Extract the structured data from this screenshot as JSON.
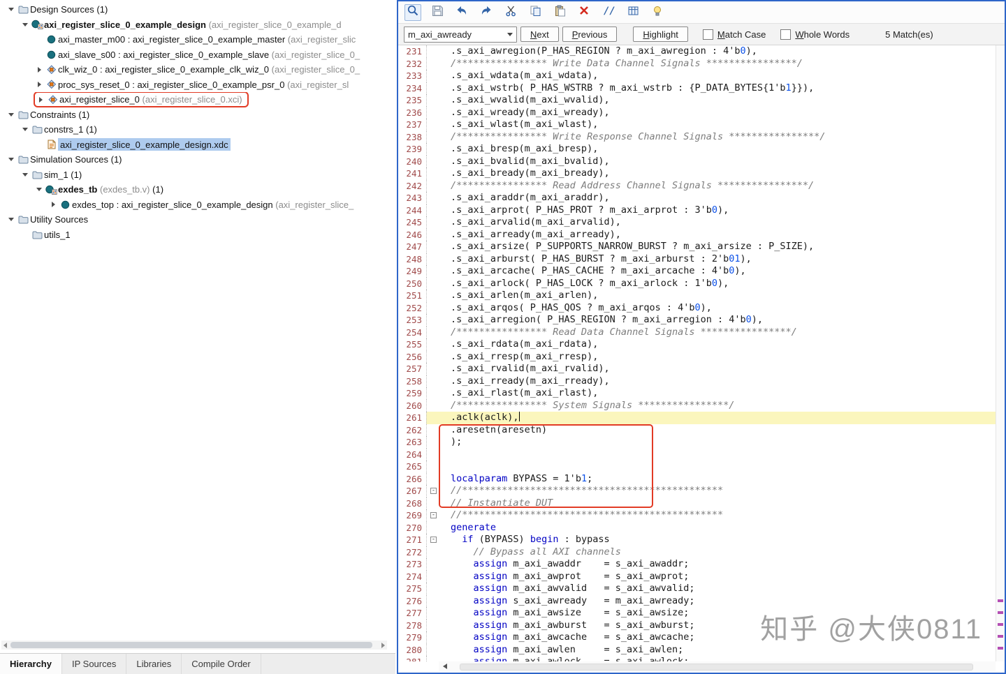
{
  "left_panel": {
    "tree": [
      {
        "indent": 0,
        "chevron": "v",
        "icon": "folder",
        "parts": [
          {
            "t": "Design Sources ",
            "s": "plain"
          },
          {
            "t": "(1)",
            "s": "plain"
          }
        ]
      },
      {
        "indent": 1,
        "chevron": "v",
        "icon": "module-h",
        "parts": [
          {
            "t": "axi_register_slice_0_example_design ",
            "s": "bold"
          },
          {
            "t": "(axi_register_slice_0_example_d",
            "s": "dim"
          }
        ]
      },
      {
        "indent": 2,
        "chevron": null,
        "icon": "module",
        "parts": [
          {
            "t": "axi_master_m00 : axi_register_slice_0_example_master ",
            "s": "plain"
          },
          {
            "t": "(axi_register_slic",
            "s": "dim"
          }
        ]
      },
      {
        "indent": 2,
        "chevron": null,
        "icon": "module",
        "parts": [
          {
            "t": "axi_slave_s00 : axi_register_slice_0_example_slave ",
            "s": "plain"
          },
          {
            "t": "(axi_register_slice_0_",
            "s": "dim"
          }
        ]
      },
      {
        "indent": 2,
        "chevron": ">",
        "icon": "ip",
        "parts": [
          {
            "t": "clk_wiz_0 : axi_register_slice_0_example_clk_wiz_0 ",
            "s": "plain"
          },
          {
            "t": "(axi_register_slice_0_",
            "s": "dim"
          }
        ]
      },
      {
        "indent": 2,
        "chevron": ">",
        "icon": "ip",
        "parts": [
          {
            "t": "proc_sys_reset_0 : axi_register_slice_0_example_psr_0 ",
            "s": "plain"
          },
          {
            "t": "(axi_register_sl",
            "s": "dim"
          }
        ]
      },
      {
        "indent": 2,
        "chevron": ">",
        "icon": "ip",
        "redbox": true,
        "parts": [
          {
            "t": "axi_register_slice_0 ",
            "s": "plain"
          },
          {
            "t": "(axi_register_slice_0.xci)",
            "s": "dim"
          }
        ]
      },
      {
        "indent": 0,
        "chevron": "v",
        "icon": "folder",
        "parts": [
          {
            "t": "Constraints ",
            "s": "plain"
          },
          {
            "t": "(1)",
            "s": "plain"
          }
        ]
      },
      {
        "indent": 1,
        "chevron": "v",
        "icon": "folder",
        "parts": [
          {
            "t": "constrs_1 ",
            "s": "plain"
          },
          {
            "t": "(1)",
            "s": "plain"
          }
        ]
      },
      {
        "indent": 2,
        "chevron": null,
        "icon": "xdc",
        "selected": true,
        "parts": [
          {
            "t": "axi_register_slice_0_example_design.xdc",
            "s": "plain"
          }
        ]
      },
      {
        "indent": 0,
        "chevron": "v",
        "icon": "folder",
        "parts": [
          {
            "t": "Simulation Sources ",
            "s": "plain"
          },
          {
            "t": "(1)",
            "s": "plain"
          }
        ]
      },
      {
        "indent": 1,
        "chevron": "v",
        "icon": "folder",
        "parts": [
          {
            "t": "sim_1 ",
            "s": "plain"
          },
          {
            "t": "(1)",
            "s": "plain"
          }
        ]
      },
      {
        "indent": 2,
        "chevron": "v",
        "icon": "module-h",
        "parts": [
          {
            "t": "exdes_tb ",
            "s": "bold"
          },
          {
            "t": "(exdes_tb.v) ",
            "s": "dim"
          },
          {
            "t": "(1)",
            "s": "plain"
          }
        ]
      },
      {
        "indent": 3,
        "chevron": ">",
        "icon": "module",
        "parts": [
          {
            "t": "exdes_top : axi_register_slice_0_example_design ",
            "s": "plain"
          },
          {
            "t": "(axi_register_slice_",
            "s": "dim"
          }
        ]
      },
      {
        "indent": 0,
        "chevron": "v",
        "icon": "folder",
        "parts": [
          {
            "t": "Utility Sources",
            "s": "plain"
          }
        ]
      },
      {
        "indent": 1,
        "chevron": null,
        "icon": "folder",
        "parts": [
          {
            "t": "utils_1",
            "s": "plain"
          }
        ]
      }
    ],
    "tabs": [
      {
        "label": "Hierarchy",
        "active": true
      },
      {
        "label": "IP Sources",
        "active": false
      },
      {
        "label": "Libraries",
        "active": false
      },
      {
        "label": "Compile Order",
        "active": false
      }
    ]
  },
  "editor": {
    "toolbar": [
      {
        "name": "find",
        "icon": "search-icon",
        "active": true
      },
      {
        "name": "save",
        "icon": "save-icon",
        "active": false
      },
      {
        "name": "undo",
        "icon": "undo-arrow-icon",
        "active": false
      },
      {
        "name": "redo",
        "icon": "redo-arrow-icon",
        "active": false
      },
      {
        "name": "cut",
        "icon": "scissors-icon",
        "active": false
      },
      {
        "name": "copy",
        "icon": "copy-icon",
        "active": false
      },
      {
        "name": "paste",
        "icon": "paste-icon",
        "active": false
      },
      {
        "name": "delete",
        "icon": "delete-x-icon",
        "active": false
      },
      {
        "name": "toggle-comment",
        "icon": "comment-slashes-icon",
        "active": false
      },
      {
        "name": "column-select",
        "icon": "grid-icon",
        "active": false
      },
      {
        "name": "quick-fix",
        "icon": "lightbulb-icon",
        "active": false
      }
    ],
    "find": {
      "query": "m_axi_awready",
      "next_label": "Next",
      "previous_label": "Previous",
      "highlight_label": "Highlight",
      "match_case_label": "Match Case",
      "whole_words_label": "Whole Words",
      "match_count": "5 Match(es)"
    },
    "code": {
      "lines": [
        {
          "n": 231,
          "seg": [
            [
              "p",
              ".s_axi_awregion(P_HAS_REGION ? m_axi_awregion : 4'b"
            ],
            [
              "n",
              "0"
            ],
            [
              "p",
              "),"
            ]
          ]
        },
        {
          "n": 232,
          "seg": [
            [
              "c",
              "/**************** Write Data Channel Signals ****************/"
            ]
          ]
        },
        {
          "n": 233,
          "seg": [
            [
              "p",
              ".s_axi_wdata(m_axi_wdata),"
            ]
          ]
        },
        {
          "n": 234,
          "seg": [
            [
              "p",
              ".s_axi_wstrb( P_HAS_WSTRB ? m_axi_wstrb : {P_DATA_BYTES{1'b"
            ],
            [
              "n",
              "1"
            ],
            [
              "p",
              "}}),"
            ]
          ]
        },
        {
          "n": 235,
          "seg": [
            [
              "p",
              ".s_axi_wvalid(m_axi_wvalid),"
            ]
          ]
        },
        {
          "n": 236,
          "seg": [
            [
              "p",
              ".s_axi_wready(m_axi_wready),"
            ]
          ]
        },
        {
          "n": 237,
          "seg": [
            [
              "p",
              ".s_axi_wlast(m_axi_wlast),"
            ]
          ]
        },
        {
          "n": 238,
          "seg": [
            [
              "c",
              "/**************** Write Response Channel Signals ****************/"
            ]
          ]
        },
        {
          "n": 239,
          "seg": [
            [
              "p",
              ".s_axi_bresp(m_axi_bresp),"
            ]
          ]
        },
        {
          "n": 240,
          "seg": [
            [
              "p",
              ".s_axi_bvalid(m_axi_bvalid),"
            ]
          ]
        },
        {
          "n": 241,
          "seg": [
            [
              "p",
              ".s_axi_bready(m_axi_bready),"
            ]
          ]
        },
        {
          "n": 242,
          "seg": [
            [
              "c",
              "/**************** Read Address Channel Signals ****************/"
            ]
          ]
        },
        {
          "n": 243,
          "seg": [
            [
              "p",
              ".s_axi_araddr(m_axi_araddr),"
            ]
          ]
        },
        {
          "n": 244,
          "seg": [
            [
              "p",
              ".s_axi_arprot( P_HAS_PROT ? m_axi_arprot : 3'b"
            ],
            [
              "n",
              "0"
            ],
            [
              "p",
              "),"
            ]
          ]
        },
        {
          "n": 245,
          "seg": [
            [
              "p",
              ".s_axi_arvalid(m_axi_arvalid),"
            ]
          ]
        },
        {
          "n": 246,
          "seg": [
            [
              "p",
              ".s_axi_arready(m_axi_arready),"
            ]
          ]
        },
        {
          "n": 247,
          "seg": [
            [
              "p",
              ".s_axi_arsize( P_SUPPORTS_NARROW_BURST ? m_axi_arsize : P_SIZE),"
            ]
          ]
        },
        {
          "n": 248,
          "seg": [
            [
              "p",
              ".s_axi_arburst( P_HAS_BURST ? m_axi_arburst : 2'b"
            ],
            [
              "n",
              "01"
            ],
            [
              "p",
              "),"
            ]
          ]
        },
        {
          "n": 249,
          "seg": [
            [
              "p",
              ".s_axi_arcache( P_HAS_CACHE ? m_axi_arcache : 4'b"
            ],
            [
              "n",
              "0"
            ],
            [
              "p",
              "),"
            ]
          ]
        },
        {
          "n": 250,
          "seg": [
            [
              "p",
              ".s_axi_arlock( P_HAS_LOCK ? m_axi_arlock : 1'b"
            ],
            [
              "n",
              "0"
            ],
            [
              "p",
              "),"
            ]
          ]
        },
        {
          "n": 251,
          "seg": [
            [
              "p",
              ".s_axi_arlen(m_axi_arlen),"
            ]
          ]
        },
        {
          "n": 252,
          "seg": [
            [
              "p",
              ".s_axi_arqos( P_HAS_QOS ? m_axi_arqos : 4'b"
            ],
            [
              "n",
              "0"
            ],
            [
              "p",
              "),"
            ]
          ]
        },
        {
          "n": 253,
          "seg": [
            [
              "p",
              ".s_axi_arregion( P_HAS_REGION ? m_axi_arregion : 4'b"
            ],
            [
              "n",
              "0"
            ],
            [
              "p",
              "),"
            ]
          ]
        },
        {
          "n": 254,
          "seg": [
            [
              "c",
              "/**************** Read Data Channel Signals ****************/"
            ]
          ]
        },
        {
          "n": 255,
          "seg": [
            [
              "p",
              ".s_axi_rdata(m_axi_rdata),"
            ]
          ]
        },
        {
          "n": 256,
          "seg": [
            [
              "p",
              ".s_axi_rresp(m_axi_rresp),"
            ]
          ]
        },
        {
          "n": 257,
          "seg": [
            [
              "p",
              ".s_axi_rvalid(m_axi_rvalid),"
            ]
          ]
        },
        {
          "n": 258,
          "seg": [
            [
              "p",
              ".s_axi_rready(m_axi_rready),"
            ]
          ]
        },
        {
          "n": 259,
          "seg": [
            [
              "p",
              ".s_axi_rlast(m_axi_rlast),"
            ]
          ]
        },
        {
          "n": 260,
          "seg": [
            [
              "c",
              "/**************** System Signals ****************/"
            ]
          ]
        },
        {
          "n": 261,
          "hl": true,
          "cursor": true,
          "seg": [
            [
              "p",
              ".aclk(aclk),"
            ]
          ]
        },
        {
          "n": 262,
          "seg": [
            [
              "p",
              ".aresetn(aresetn)"
            ]
          ]
        },
        {
          "n": 263,
          "seg": [
            [
              "p",
              ");"
            ]
          ]
        },
        {
          "n": 264,
          "seg": []
        },
        {
          "n": 265,
          "seg": []
        },
        {
          "n": 266,
          "seg": [
            [
              "k",
              "localparam"
            ],
            [
              "p",
              " BYPASS = 1'b"
            ],
            [
              "n",
              "1"
            ],
            [
              "p",
              ";"
            ]
          ]
        },
        {
          "n": 267,
          "fold": true,
          "seg": [
            [
              "c",
              "//**********************************************"
            ]
          ]
        },
        {
          "n": 268,
          "seg": [
            [
              "c",
              "// Instantiate DUT"
            ]
          ]
        },
        {
          "n": 269,
          "fold": true,
          "seg": [
            [
              "c",
              "//**********************************************"
            ]
          ]
        },
        {
          "n": 270,
          "seg": [
            [
              "k",
              "generate"
            ]
          ]
        },
        {
          "n": 271,
          "fold": true,
          "seg": [
            [
              "p",
              "  "
            ],
            [
              "k",
              "if"
            ],
            [
              "p",
              " (BYPASS) "
            ],
            [
              "k",
              "begin"
            ],
            [
              "p",
              " : bypass"
            ]
          ]
        },
        {
          "n": 272,
          "seg": [
            [
              "p",
              "    "
            ],
            [
              "c",
              "// Bypass all AXI channels"
            ]
          ]
        },
        {
          "n": 273,
          "seg": [
            [
              "p",
              "    "
            ],
            [
              "k",
              "assign"
            ],
            [
              "p",
              " m_axi_awaddr    = s_axi_awaddr;"
            ]
          ]
        },
        {
          "n": 274,
          "seg": [
            [
              "p",
              "    "
            ],
            [
              "k",
              "assign"
            ],
            [
              "p",
              " m_axi_awprot    = s_axi_awprot;"
            ]
          ]
        },
        {
          "n": 275,
          "seg": [
            [
              "p",
              "    "
            ],
            [
              "k",
              "assign"
            ],
            [
              "p",
              " m_axi_awvalid   = s_axi_awvalid;"
            ]
          ]
        },
        {
          "n": 276,
          "seg": [
            [
              "p",
              "    "
            ],
            [
              "k",
              "assign"
            ],
            [
              "p",
              " s_axi_awready   = m_axi_awready;"
            ]
          ]
        },
        {
          "n": 277,
          "seg": [
            [
              "p",
              "    "
            ],
            [
              "k",
              "assign"
            ],
            [
              "p",
              " m_axi_awsize    = s_axi_awsize;"
            ]
          ]
        },
        {
          "n": 278,
          "seg": [
            [
              "p",
              "    "
            ],
            [
              "k",
              "assign"
            ],
            [
              "p",
              " m_axi_awburst   = s_axi_awburst;"
            ]
          ]
        },
        {
          "n": 279,
          "seg": [
            [
              "p",
              "    "
            ],
            [
              "k",
              "assign"
            ],
            [
              "p",
              " m_axi_awcache   = s_axi_awcache;"
            ]
          ]
        },
        {
          "n": 280,
          "seg": [
            [
              "p",
              "    "
            ],
            [
              "k",
              "assign"
            ],
            [
              "p",
              " m_axi_awlen     = s_axi_awlen;"
            ]
          ]
        },
        {
          "n": 281,
          "seg": [
            [
              "p",
              "    "
            ],
            [
              "k",
              "assign"
            ],
            [
              "p",
              " m_axi_awlock    = s_axi_awlock;"
            ]
          ]
        }
      ]
    }
  },
  "watermark": "知乎 @大侠0811"
}
